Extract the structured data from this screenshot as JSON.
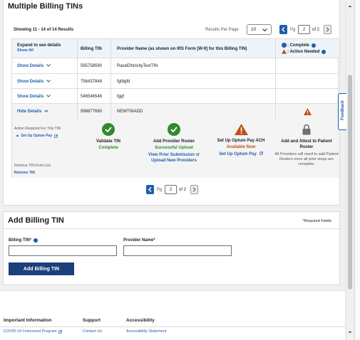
{
  "billing": {
    "title": "Multiple Billing TINs",
    "showing": "Showing 11 - 14 of 14 Results",
    "results_per_page_label": "Results Per Page",
    "results_per_page_value": "10",
    "pager_top": {
      "pg_label": "Pg",
      "current": "2",
      "of_label": "of 2"
    },
    "columns": {
      "expand": "Expand to see details",
      "show_all": "Show All",
      "billing_tin": "Billing TIN",
      "provider_name": "Provider Name (as shown on IRS Form [W-9] for this Billing TIN)",
      "complete_legend": ": Complete",
      "action_needed_legend": ": Action Needed"
    },
    "rows": [
      {
        "toggle": "Show Details",
        "tin": "565758590",
        "name": "RaceEthnicityTestTIN"
      },
      {
        "toggle": "Show Details",
        "tin": "756437848",
        "name": "fgfdgfd"
      },
      {
        "toggle": "Show Details",
        "tin": "546546546",
        "name": "fggf"
      },
      {
        "toggle": "Hide Details",
        "tin": "998877660",
        "name": "NEWTINADD"
      }
    ],
    "details": {
      "action_required_label": "Action Required For This TIN:",
      "action_link": "Set Up Optum Pay",
      "remove_label": "Remove TIN From List:",
      "remove_link": "Remove TIN",
      "steps": [
        {
          "title": "Validate TIN",
          "status": "Complete"
        },
        {
          "title": "Add Provider Roster",
          "status": "Successful Upload",
          "link1": "View Prior Submission",
          "or": "or",
          "link2": "Upload New Providers"
        },
        {
          "title": "Set Up Optum Pay ACH",
          "status": "Available Now",
          "link1": "Set Up Optum Pay"
        },
        {
          "title": "Add and Attest to Patient Roster",
          "note": "All Providers will need to add Patient Rosters once all prior steps are complete."
        }
      ]
    },
    "pager_bottom": {
      "pg_label": "Pg",
      "current": "2",
      "of_label": "of 2"
    }
  },
  "add_tin": {
    "title": "Add Billing TIN",
    "required_note": "*Required Fields",
    "tin_label": "Billing TIN*",
    "provider_label": "Provider Name*",
    "tin_value": "",
    "provider_value": "",
    "submit": "Add Billing TIN"
  },
  "feedback": "Feedback",
  "footer": {
    "important_info": "Important Information",
    "covid_link": "COVID-19 Uninsured Program",
    "support": "Support",
    "contact_us": "Contact Us",
    "accessibility": "Accessibility",
    "accessibility_statement": "Accessibility Statement"
  },
  "colors": {
    "green": "#2e8b2e",
    "orange": "#c0501c",
    "blue": "#1f5fae",
    "navy": "#1b3f7a",
    "grey_lock": "#6f6f6f"
  }
}
